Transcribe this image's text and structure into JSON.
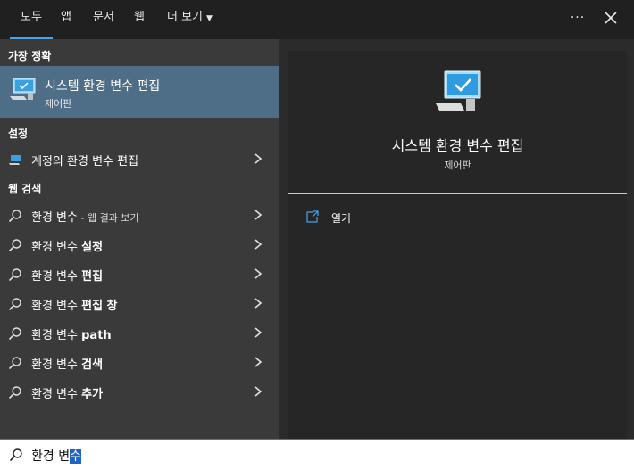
{
  "tabs": [
    {
      "label": "모두",
      "active": true
    },
    {
      "label": "앱"
    },
    {
      "label": "문서"
    },
    {
      "label": "웹"
    },
    {
      "label": "더 보기"
    }
  ],
  "more_label": "···",
  "left": {
    "best_match_header": "가장 정확",
    "best_match": {
      "title": "시스템 환경 변수 편집",
      "subtitle": "제어판",
      "icon": "monitor-check-icon"
    },
    "settings_header": "설정",
    "settings_item": {
      "label": "계정의 환경 변수 편집",
      "icon": "account-settings-icon"
    },
    "web_header": "웹 검색",
    "web_items": [
      {
        "prefix": "환경 변수",
        "bold": "",
        "suffix": " - 웹 결과 보기"
      },
      {
        "prefix": "환경 변수 ",
        "bold": "설정",
        "suffix": ""
      },
      {
        "prefix": "환경 변수 ",
        "bold": "편집",
        "suffix": ""
      },
      {
        "prefix": "환경 변수 ",
        "bold": "편집 창",
        "suffix": ""
      },
      {
        "prefix": "환경 변수 ",
        "bold": "path",
        "suffix": ""
      },
      {
        "prefix": "환경 변수 ",
        "bold": "검색",
        "suffix": ""
      },
      {
        "prefix": "환경 변수 ",
        "bold": "추가",
        "suffix": ""
      }
    ]
  },
  "preview": {
    "title": "시스템 환경 변수 편집",
    "subtitle": "제어판",
    "open_label": "열기"
  },
  "search": {
    "typed": "환경 변",
    "selected": "수"
  },
  "colors": {
    "accent": "#4aa3e8",
    "best_match_bg": "#4e6d87",
    "selection": "#1e64c8"
  }
}
